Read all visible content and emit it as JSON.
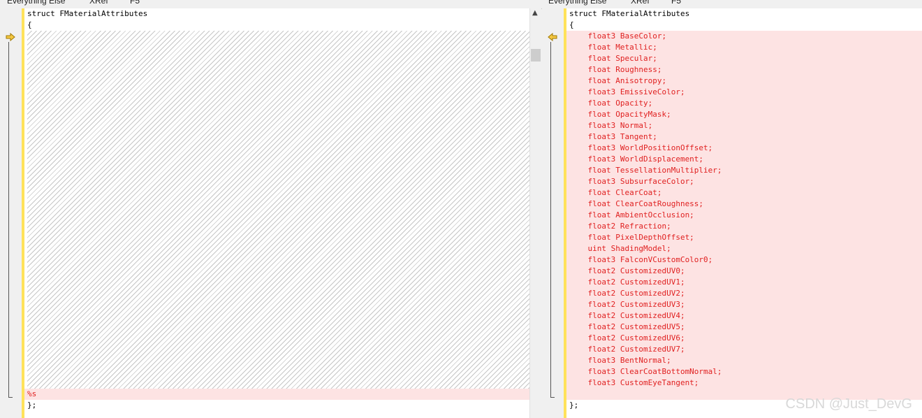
{
  "topbar": {
    "left_items": [
      "Everything Else",
      "XRef",
      "F5"
    ],
    "right_items": [
      "Everything Else",
      "XRef",
      "F5"
    ]
  },
  "left": {
    "header_lines": [
      "struct FMaterialAttributes",
      "{"
    ],
    "missing_line": "%s",
    "closing_line": "};"
  },
  "right": {
    "header_lines": [
      "struct FMaterialAttributes",
      "{"
    ],
    "fields": [
      "    float3 BaseColor;",
      "    float Metallic;",
      "    float Specular;",
      "    float Roughness;",
      "    float Anisotropy;",
      "    float3 EmissiveColor;",
      "    float Opacity;",
      "    float OpacityMask;",
      "    float3 Normal;",
      "    float3 Tangent;",
      "    float3 WorldPositionOffset;",
      "    float3 WorldDisplacement;",
      "    float TessellationMultiplier;",
      "    float3 SubsurfaceColor;",
      "    float ClearCoat;",
      "    float ClearCoatRoughness;",
      "    float AmbientOcclusion;",
      "    float2 Refraction;",
      "    float PixelDepthOffset;",
      "    uint ShadingModel;",
      "    float3 FalconVCustomColor0;",
      "    float2 CustomizedUV0;",
      "    float2 CustomizedUV1;",
      "    float2 CustomizedUV2;",
      "    float2 CustomizedUV3;",
      "    float2 CustomizedUV4;",
      "    float2 CustomizedUV5;",
      "    float2 CustomizedUV6;",
      "    float2 CustomizedUV7;",
      "    float3 BentNormal;",
      "    float3 ClearCoatBottomNormal;",
      "    float3 CustomEyeTangent;"
    ],
    "closing_line": "};"
  },
  "icons": {
    "left_marker": "arrow-right-icon",
    "right_marker": "arrow-left-icon",
    "scroll_up": "chevron-up-icon"
  },
  "colors": {
    "diff_removed": "#fde3e3",
    "diff_text": "#e02020",
    "change_bar": "#ffe25a"
  },
  "watermark": "CSDN @Just_DevG"
}
